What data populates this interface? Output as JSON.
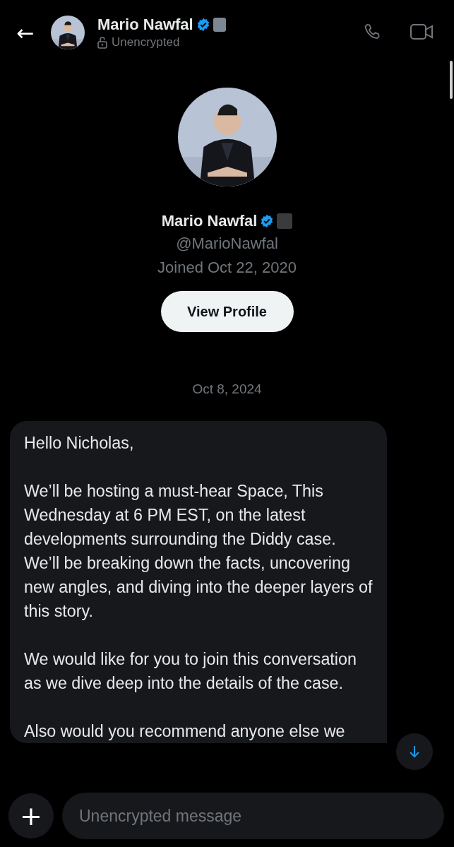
{
  "header": {
    "back": "←",
    "name": "Mario Nawfal",
    "verified": true,
    "status": "Unencrypted"
  },
  "profile": {
    "name": "Mario Nawfal",
    "verified": true,
    "handle": "@MarioNawfal",
    "joined": "Joined Oct 22, 2020",
    "button": "View Profile"
  },
  "date": "Oct 8, 2024",
  "messages": [
    {
      "paragraphs": [
        "Hello Nicholas,",
        "We’ll be hosting a must-hear Space, This Wednesday at 6 PM EST, on the latest developments surrounding the Diddy case. We’ll be breaking down the facts, uncovering new angles, and diving into the deeper layers of this story.",
        "We would like for you to join this conversation as we dive deep into the details of the case.",
        "Also would you recommend anyone else we"
      ]
    }
  ],
  "composer": {
    "add": "+",
    "placeholder": "Unencrypted message"
  }
}
